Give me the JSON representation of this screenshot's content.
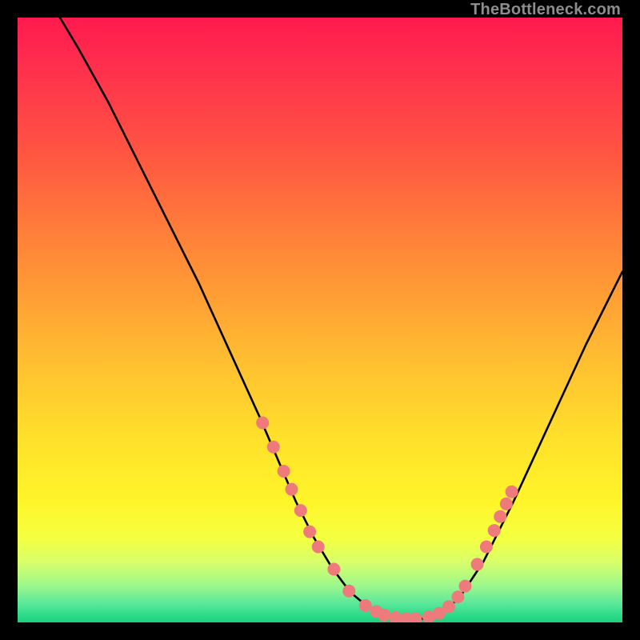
{
  "watermark": "TheBottleneck.com",
  "chart_data": {
    "type": "line",
    "title": "",
    "xlabel": "",
    "ylabel": "",
    "xlim": [
      0,
      100
    ],
    "ylim": [
      0,
      100
    ],
    "grid": false,
    "legend": false,
    "series": [
      {
        "name": "bottleneck-curve",
        "color": "#000000",
        "x": [
          7,
          10,
          15,
          20,
          25,
          30,
          35,
          40,
          43,
          46,
          49,
          52,
          55,
          58,
          61,
          64,
          67,
          70,
          73,
          77,
          82,
          88,
          94,
          100
        ],
        "y": [
          100,
          95,
          86,
          76,
          66,
          56,
          45,
          34,
          27,
          20,
          14,
          9,
          5,
          2.5,
          1.2,
          0.6,
          0.6,
          1.5,
          4,
          10,
          20,
          33,
          46,
          58
        ]
      }
    ],
    "markers": {
      "color": "#ee7a7b",
      "radius_px": 8,
      "points": [
        {
          "x": 40.5,
          "y": 33
        },
        {
          "x": 42.3,
          "y": 29
        },
        {
          "x": 44.0,
          "y": 25
        },
        {
          "x": 45.3,
          "y": 22
        },
        {
          "x": 46.8,
          "y": 18.5
        },
        {
          "x": 48.3,
          "y": 15
        },
        {
          "x": 49.7,
          "y": 12.5
        },
        {
          "x": 52.3,
          "y": 8.8
        },
        {
          "x": 54.8,
          "y": 5.2
        },
        {
          "x": 57.5,
          "y": 2.8
        },
        {
          "x": 59.3,
          "y": 1.8
        },
        {
          "x": 60.6,
          "y": 1.2
        },
        {
          "x": 62.5,
          "y": 0.8
        },
        {
          "x": 64.3,
          "y": 0.6
        },
        {
          "x": 65.8,
          "y": 0.6
        },
        {
          "x": 68.0,
          "y": 0.9
        },
        {
          "x": 69.7,
          "y": 1.5
        },
        {
          "x": 71.3,
          "y": 2.6
        },
        {
          "x": 72.8,
          "y": 4.2
        },
        {
          "x": 74.0,
          "y": 6.0
        },
        {
          "x": 76.0,
          "y": 9.6
        },
        {
          "x": 77.5,
          "y": 12.5
        },
        {
          "x": 78.8,
          "y": 15.2
        },
        {
          "x": 79.8,
          "y": 17.5
        },
        {
          "x": 80.8,
          "y": 19.6
        },
        {
          "x": 81.7,
          "y": 21.6
        }
      ]
    }
  }
}
